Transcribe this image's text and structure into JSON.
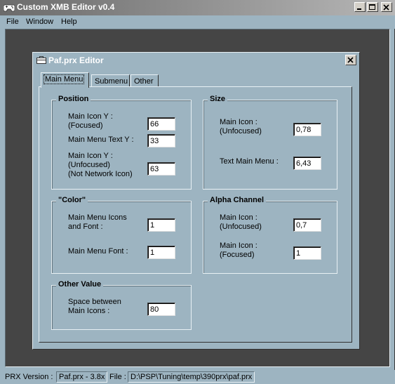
{
  "window": {
    "title": "Custom XMB Editor v0.4",
    "controls": [
      "minimize-icon",
      "maximize-icon",
      "close-icon"
    ]
  },
  "menu": {
    "file": "File",
    "window": "Window",
    "help": "Help"
  },
  "child": {
    "title": "Paf.prx Editor",
    "tabs": [
      "Main Menu",
      "Submenu",
      "Other"
    ],
    "active_tab": "Main Menu"
  },
  "position": {
    "title": "Position",
    "icon_y_focused_label": "Main Icon Y :\n(Focused)",
    "icon_y_focused_value": "66",
    "text_y_label": "Main Menu Text Y :",
    "text_y_value": "33",
    "icon_y_unfocused_label": "Main Icon Y :\n(Unfocused)\n(Not Network Icon)",
    "icon_y_unfocused_value": "63"
  },
  "size": {
    "title": "Size",
    "main_icon_label": "Main Icon :\n(Unfocused)",
    "main_icon_value": "0,78",
    "text_main_menu_label": "Text Main Menu :",
    "text_main_menu_value": "6,43"
  },
  "color": {
    "title": "\"Color\"",
    "icons_font_label": "Main Menu Icons\nand Font :",
    "icons_font_value": "1",
    "font_label": "Main Menu Font :",
    "font_value": "1"
  },
  "alpha": {
    "title": "Alpha Channel",
    "unfocused_label": "Main Icon :\n(Unfocused)",
    "unfocused_value": "0,7",
    "focused_label": "Main Icon :\n(Focused)",
    "focused_value": "1"
  },
  "other": {
    "title": "Other Value",
    "spacing_label": "Space between\nMain Icons :",
    "spacing_value": "80"
  },
  "status": {
    "prx_version_label": "PRX Version :",
    "prx_version_value": "Paf.prx - 3.8x",
    "file_label": "File :",
    "file_value": "D:\\PSP\\Tuning\\temp\\390prx\\paf.prx"
  },
  "colors": {
    "face": "#9db4c1",
    "mdi_background": "#454545"
  }
}
